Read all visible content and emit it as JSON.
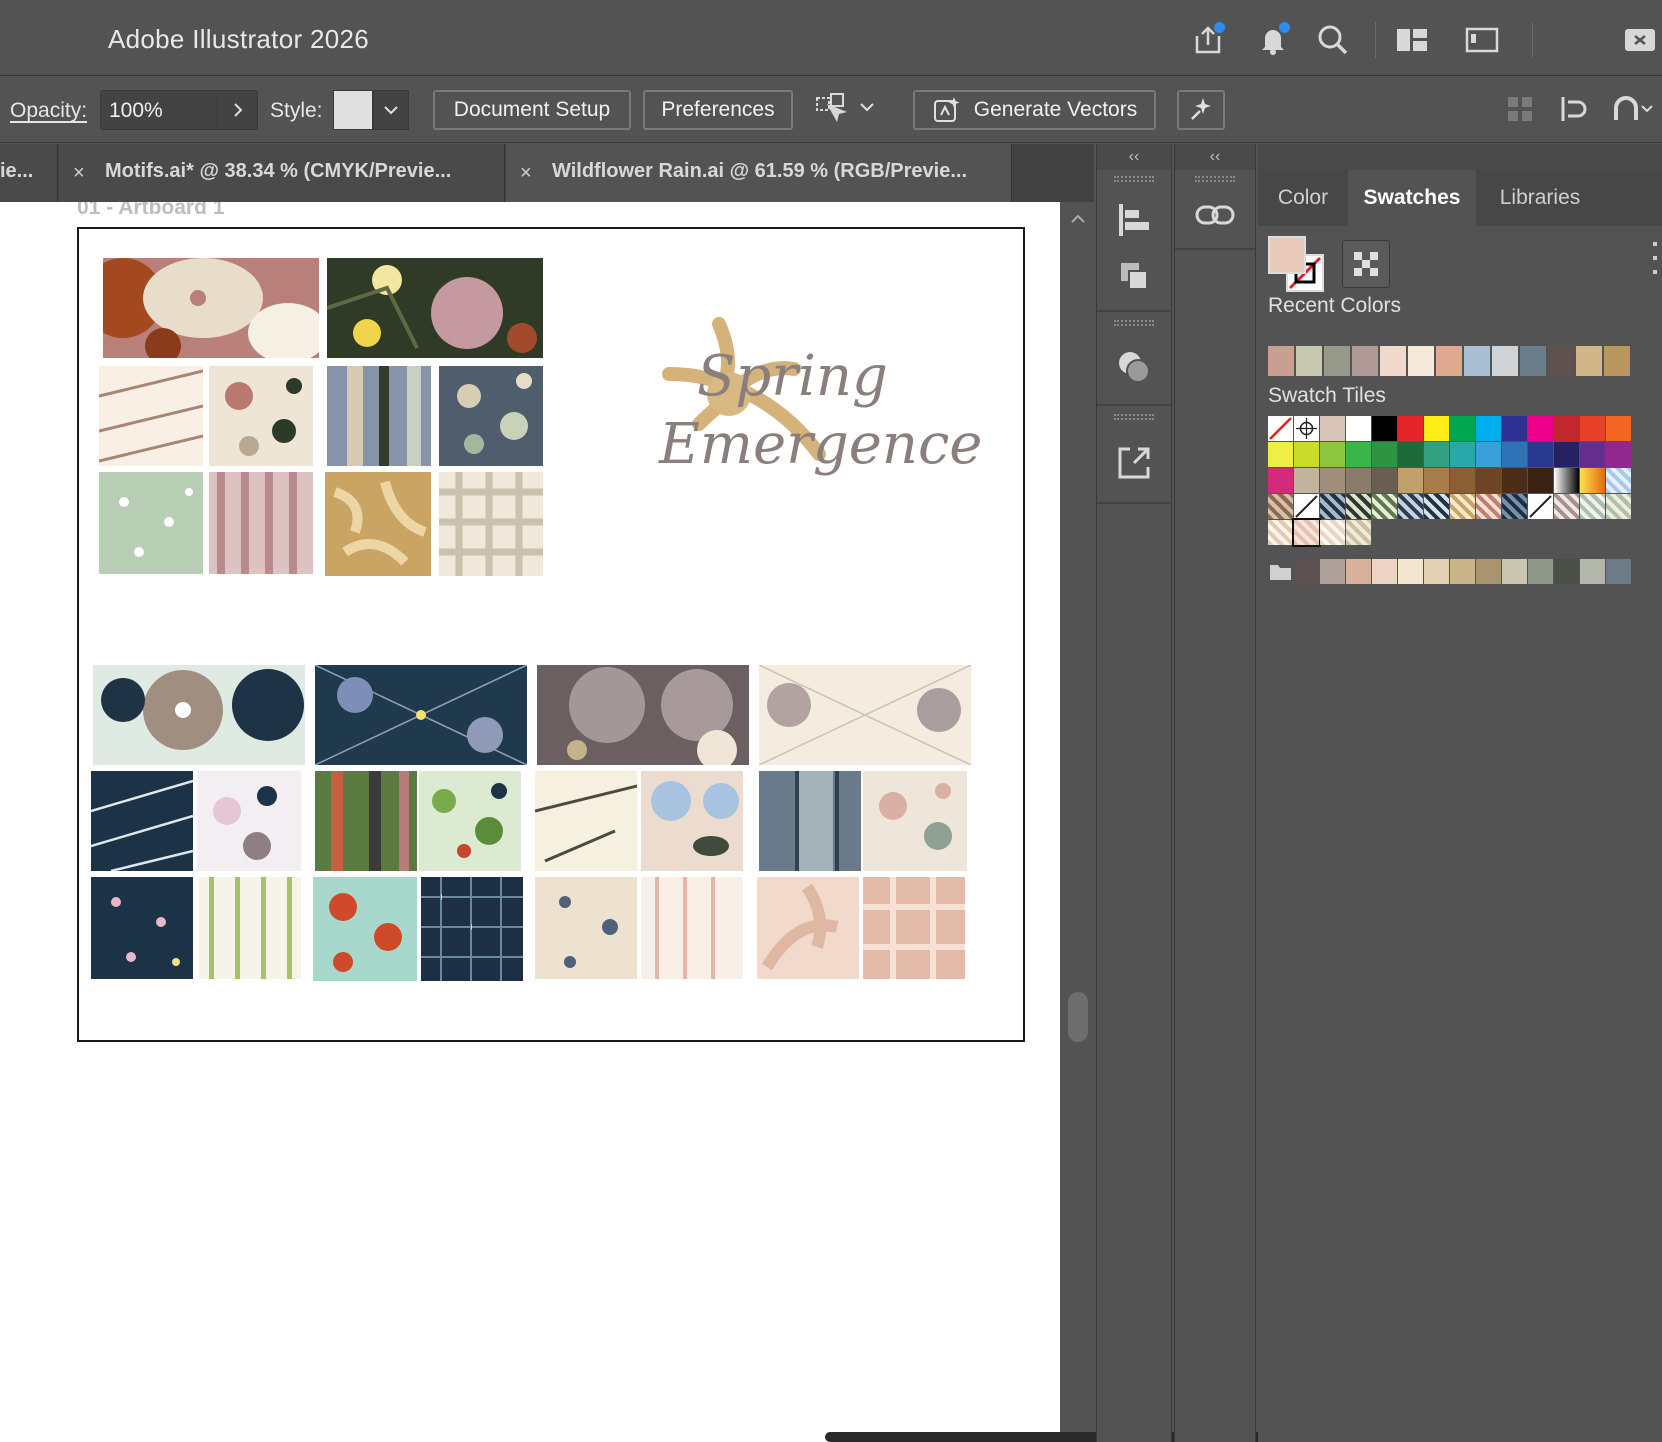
{
  "app": {
    "title": "Adobe Illustrator 2026"
  },
  "titlebar_icons": [
    "share-icon",
    "notification-bell-icon",
    "search-icon",
    "workspace-switcher-icon",
    "screen-mode-icon",
    "arrange-documents-icon"
  ],
  "control_bar": {
    "opacity_label": "Opacity:",
    "opacity_value": "100%",
    "style_label": "Style:",
    "document_setup": "Document Setup",
    "preferences": "Preferences",
    "generate_vectors": "Generate Vectors"
  },
  "doc_tabs": [
    {
      "label": "ie...",
      "close": ""
    },
    {
      "label": "Motifs.ai* @ 38.34 % (CMYK/Previe...",
      "close": "×"
    },
    {
      "label": "Wildflower Rain.ai @ 61.59 % (RGB/Previe...",
      "close": "×"
    }
  ],
  "canvas": {
    "artboard_label": "01 - Artboard 1",
    "logo_line1": "Spring",
    "logo_line2": "Emergence"
  },
  "panel": {
    "collapse_glyph": "‹‹",
    "tabs": [
      "Color",
      "Swatches",
      "Libraries"
    ],
    "active_tab": "Swatches",
    "recent_colors_label": "Recent Colors",
    "swatch_tiles_label": "Swatch Tiles",
    "recent_colors": [
      "#c99f8f",
      "#c8c8b0",
      "#97998a",
      "#b09a97",
      "#f0d8cc",
      "#f5e9dc",
      "#dea98f",
      "#a9c0d4",
      "#d0d4d6",
      "#6b7d89",
      "#5e5150",
      "#d1b68a",
      "#b8965e"
    ],
    "swatch_rows": [
      [
        "none",
        "#ffffff-reg",
        "#d8c4b8",
        "#ffffff",
        "#000000",
        "#e4262b",
        "#ffed19",
        "#00a650",
        "#00aeef",
        "#2e3192",
        "#ec008c",
        "#c1272d",
        "#e8412b",
        "#f26522"
      ],
      [
        "#f0ee45",
        "#cbdb2a",
        "#8dc63f",
        "#39b54a",
        "#2e9444",
        "#1e6b3a",
        "#33a17f",
        "#2aa8a8",
        "#3aa1d8",
        "#2e73b8",
        "#2a3990",
        "#262261",
        "#662d91",
        "#92278f"
      ],
      [
        "#d4297d",
        "#c3b39a",
        "#9f8e7c",
        "#8a7b6a",
        "#6b5d4f",
        "#c2a06b",
        "#a87d4a",
        "#8b5e34",
        "#6d4524",
        "#4b2d17",
        "#3b2313",
        "gradient-bw",
        "gradient-yellow",
        "pattern-blue"
      ],
      [
        "pattern-brown",
        "none-stroke",
        "pattern-navy",
        "pattern-dark",
        "pattern-green",
        "pattern-navy2",
        "pattern-navy3",
        "pattern-gold",
        "pattern-rose",
        "pattern-navy4",
        "none-stroke",
        "pattern-mauve",
        "pattern-pale",
        "pattern-sage"
      ],
      [
        "pattern-stripe",
        "pattern-selected",
        "pattern-stripe2",
        "pattern-cream"
      ],
      [
        "folder",
        "#5c5050",
        "#b0a09a",
        "#d9b09a",
        "#ecd5c4",
        "#f4e7d0",
        "#e1d1b2",
        "#c9b48a",
        "#a99470",
        "#c8c6b1",
        "#8e9889",
        "#4a4f47",
        "#b2b6ab",
        "#6d7b86"
      ]
    ]
  }
}
